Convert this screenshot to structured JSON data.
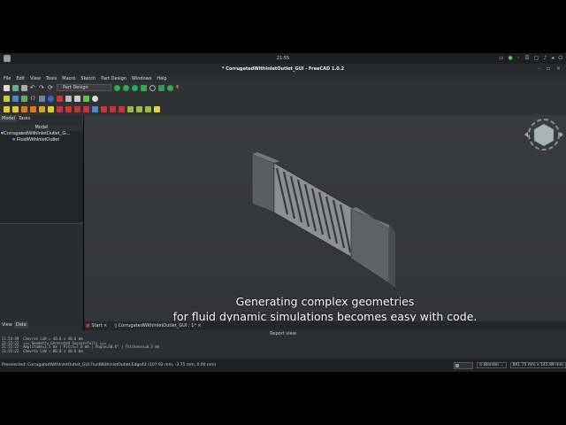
{
  "system": {
    "clock": "21:55"
  },
  "window": {
    "title": "* CorrugatedWithInletOutlet_GUI - FreeCAD 1.0.2"
  },
  "menu": [
    "File",
    "Edit",
    "View",
    "Tools",
    "Macro",
    "Sketch",
    "Part Design",
    "Windows",
    "Help"
  ],
  "toolbar": {
    "workbench": "Part Design"
  },
  "left_panel": {
    "tabs": [
      "Model",
      "Tasks"
    ],
    "header": "Model",
    "tree": [
      {
        "label": "CorrugatedWithInletOutlet_G..."
      },
      {
        "label": "FluidWithInletOutlet"
      }
    ],
    "bottom_tabs": [
      "View",
      "Data"
    ]
  },
  "caption": {
    "line1": "Generating complex geometries",
    "line2": "for fluid dynamic simulations becomes easy with code."
  },
  "doc_tabs": [
    {
      "label": "Start"
    },
    {
      "label": "CorrugatedWithInletOutlet_GUI : 1*"
    }
  ],
  "report": {
    "title": "Report view",
    "lines": [
      "21:54:49  Chevron LxW = 40.0 x 40.0 mm",
      "21:55:22  === Geometry Generated Successfully ===",
      "21:55:22  Amplitude=2.5 mm | Pitch=7.0 mm | Angle=50.0° | Thickness=0.5 mm",
      "21:55:22  Chevron LxW = 80.0 x 40.0 mm"
    ]
  },
  "status": {
    "preselected": "Preselected: CorrugatedWithInletOutlet_GUI.FluidWithInletOutlet.Edge43 (107.92 mm, -3.75 mm, 0.00 mm)",
    "nav_style": "Blender",
    "dimensions": "841.75 mm x 145.89 mm"
  },
  "colors": {
    "accent": "#5b9bd5"
  }
}
